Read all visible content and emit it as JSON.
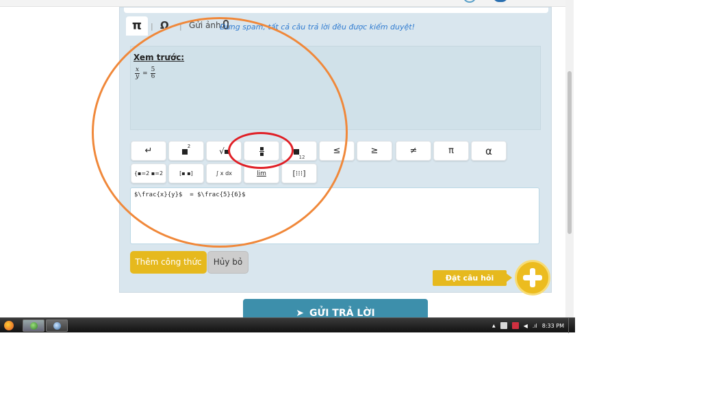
{
  "toolbar_tabs": {
    "pi_tab": "π",
    "omega_tab": "Ω",
    "separator": "|",
    "send_image": "Gửi ảnh:"
  },
  "notice": "Đừng spam, tất cả câu trả lời đều được kiểm duyệt!",
  "preview": {
    "title": "Xem trước:",
    "lhs_num": "x",
    "lhs_den": "y",
    "equals": "=",
    "rhs_num": "5",
    "rhs_den": "6"
  },
  "math_buttons_row1": {
    "newline": "↵",
    "power_sup": "2",
    "root": "√",
    "subscript_sub": "12",
    "leq": "≤",
    "geq": "≥",
    "neq": "≠",
    "pi": "π",
    "alpha": "α"
  },
  "math_buttons_row2": {
    "system": "{▪=2 ▪=2",
    "matrix": "[▪ ▪]",
    "integral": "∫ x dx",
    "limit": "lim",
    "grid": "[⁝⁝⁝]"
  },
  "latex_input": {
    "value": "$\\frac{x}{y}$  = $\\frac{5}{6}$"
  },
  "buttons": {
    "add_formula": "Thêm công thức",
    "cancel": "Hủy bỏ",
    "ask_question": "Đặt câu hỏi",
    "send_reply": "GỬI TRẢ LỜI"
  },
  "taskbar": {
    "clock": "8:33 PM"
  },
  "colors": {
    "accent_yellow": "#e6b91e",
    "send_blue": "#3d8fab",
    "annotation_orange": "#f0883a",
    "annotation_red": "#e01f26"
  }
}
